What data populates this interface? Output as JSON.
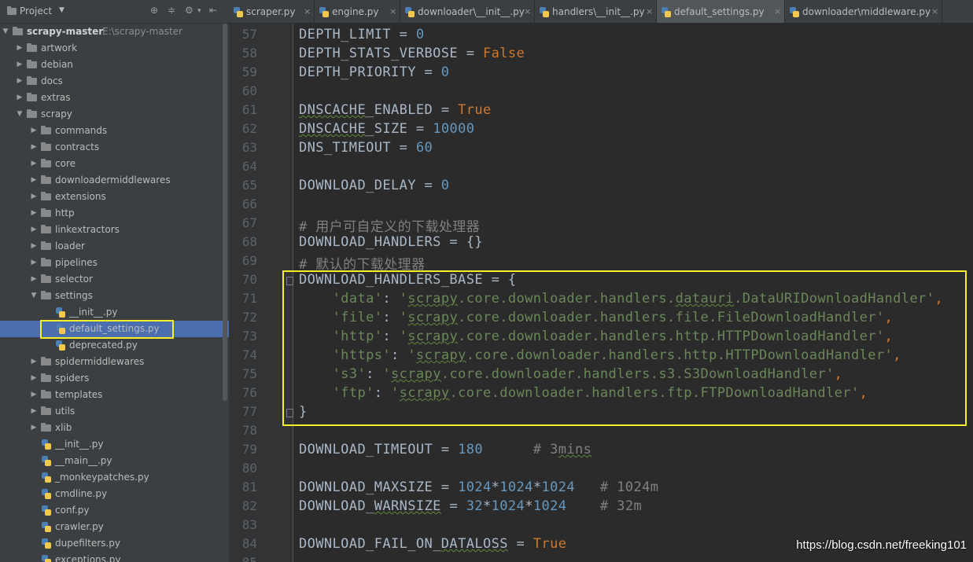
{
  "project": {
    "title": "Project",
    "tree": [
      {
        "label": "scrapy-master",
        "sublabel": "E:\\scrapy-master",
        "kind": "folder",
        "depth": 0,
        "expanded": true,
        "bold": true
      },
      {
        "label": "artwork",
        "kind": "folder",
        "depth": 1,
        "expanded": false
      },
      {
        "label": "debian",
        "kind": "folder",
        "depth": 1,
        "expanded": false
      },
      {
        "label": "docs",
        "kind": "folder",
        "depth": 1,
        "expanded": false
      },
      {
        "label": "extras",
        "kind": "folder",
        "depth": 1,
        "expanded": false
      },
      {
        "label": "scrapy",
        "kind": "folder",
        "depth": 1,
        "expanded": true
      },
      {
        "label": "commands",
        "kind": "folder",
        "depth": 2,
        "expanded": false
      },
      {
        "label": "contracts",
        "kind": "folder",
        "depth": 2,
        "expanded": false
      },
      {
        "label": "core",
        "kind": "folder",
        "depth": 2,
        "expanded": false
      },
      {
        "label": "downloadermiddlewares",
        "kind": "folder",
        "depth": 2,
        "expanded": false
      },
      {
        "label": "extensions",
        "kind": "folder",
        "depth": 2,
        "expanded": false
      },
      {
        "label": "http",
        "kind": "folder",
        "depth": 2,
        "expanded": false
      },
      {
        "label": "linkextractors",
        "kind": "folder",
        "depth": 2,
        "expanded": false
      },
      {
        "label": "loader",
        "kind": "folder",
        "depth": 2,
        "expanded": false
      },
      {
        "label": "pipelines",
        "kind": "folder",
        "depth": 2,
        "expanded": false
      },
      {
        "label": "selector",
        "kind": "folder",
        "depth": 2,
        "expanded": false
      },
      {
        "label": "settings",
        "kind": "folder",
        "depth": 2,
        "expanded": true
      },
      {
        "label": "__init__.py",
        "kind": "file",
        "depth": 3
      },
      {
        "label": "default_settings.py",
        "kind": "file",
        "depth": 3,
        "selected": true
      },
      {
        "label": "deprecated.py",
        "kind": "file",
        "depth": 3
      },
      {
        "label": "spidermiddlewares",
        "kind": "folder",
        "depth": 2,
        "expanded": false
      },
      {
        "label": "spiders",
        "kind": "folder",
        "depth": 2,
        "expanded": false
      },
      {
        "label": "templates",
        "kind": "folder",
        "depth": 2,
        "expanded": false
      },
      {
        "label": "utils",
        "kind": "folder",
        "depth": 2,
        "expanded": false
      },
      {
        "label": "xlib",
        "kind": "folder",
        "depth": 2,
        "expanded": false
      },
      {
        "label": "__init__.py",
        "kind": "file",
        "depth": 2
      },
      {
        "label": "__main__.py",
        "kind": "file",
        "depth": 2
      },
      {
        "label": "_monkeypatches.py",
        "kind": "file",
        "depth": 2
      },
      {
        "label": "cmdline.py",
        "kind": "file",
        "depth": 2
      },
      {
        "label": "conf.py",
        "kind": "file",
        "depth": 2
      },
      {
        "label": "crawler.py",
        "kind": "file",
        "depth": 2
      },
      {
        "label": "dupefilters.py",
        "kind": "file",
        "depth": 2
      },
      {
        "label": "exceptions.py",
        "kind": "file",
        "depth": 2
      }
    ]
  },
  "tabs": [
    {
      "label": "scraper.py",
      "active": false
    },
    {
      "label": "engine.py",
      "active": false
    },
    {
      "label": "downloader\\__init__.py",
      "active": false
    },
    {
      "label": "handlers\\__init__.py",
      "active": false
    },
    {
      "label": "default_settings.py",
      "active": true
    },
    {
      "label": "downloader\\middleware.py",
      "active": false
    }
  ],
  "editor": {
    "lines": [
      {
        "n": 57,
        "parts": [
          [
            "DEPTH_LIMIT",
            ""
          ],
          [
            " = ",
            ""
          ],
          [
            "0",
            "num"
          ]
        ]
      },
      {
        "n": 58,
        "parts": [
          [
            "DEPTH_STATS_VERBOSE",
            ""
          ],
          [
            " = ",
            ""
          ],
          [
            "False",
            "kw"
          ]
        ]
      },
      {
        "n": 59,
        "parts": [
          [
            "DEPTH_PRIORITY",
            ""
          ],
          [
            " = ",
            ""
          ],
          [
            "0",
            "num"
          ]
        ]
      },
      {
        "n": 60,
        "parts": []
      },
      {
        "n": 61,
        "parts": [
          [
            "DNSCACHE",
            "wv"
          ],
          [
            "_ENABLED",
            ""
          ],
          [
            " = ",
            ""
          ],
          [
            "True",
            "kw"
          ]
        ]
      },
      {
        "n": 62,
        "parts": [
          [
            "DNSCACHE",
            "wv"
          ],
          [
            "_SIZE",
            ""
          ],
          [
            " = ",
            ""
          ],
          [
            "10000",
            "num"
          ]
        ]
      },
      {
        "n": 63,
        "parts": [
          [
            "DNS_TIMEOUT",
            ""
          ],
          [
            " = ",
            ""
          ],
          [
            "60",
            "num"
          ]
        ]
      },
      {
        "n": 64,
        "parts": []
      },
      {
        "n": 65,
        "parts": [
          [
            "DOWNLOAD_DELAY",
            ""
          ],
          [
            " = ",
            ""
          ],
          [
            "0",
            "num"
          ]
        ]
      },
      {
        "n": 66,
        "parts": []
      },
      {
        "n": 67,
        "parts": [
          [
            "# 用户可自定义的下载处理器",
            "cm"
          ]
        ]
      },
      {
        "n": 68,
        "parts": [
          [
            "DOWNLOAD_HANDLERS",
            ""
          ],
          [
            " = {}",
            ""
          ]
        ]
      },
      {
        "n": 69,
        "parts": [
          [
            "# 默认的下载处理器",
            "cm"
          ]
        ]
      },
      {
        "n": 70,
        "parts": [
          [
            "DOWNLOAD_HANDLERS_BASE",
            ""
          ],
          [
            " = {",
            ""
          ]
        ]
      },
      {
        "n": 71,
        "parts": [
          [
            "    ",
            ""
          ],
          [
            "'data'",
            "str"
          ],
          [
            ": ",
            ""
          ],
          [
            "'",
            "str"
          ],
          [
            "scrapy",
            "str wv"
          ],
          [
            ".core.downloader.handlers.",
            "str"
          ],
          [
            "datauri",
            "str wv"
          ],
          [
            ".DataURIDownloadHandler'",
            "str"
          ],
          [
            ",",
            "kw"
          ]
        ]
      },
      {
        "n": 72,
        "parts": [
          [
            "    ",
            ""
          ],
          [
            "'file'",
            "str"
          ],
          [
            ": ",
            ""
          ],
          [
            "'",
            "str"
          ],
          [
            "scrapy",
            "str wv"
          ],
          [
            ".core.downloader.handlers.file.FileDownloadHandler'",
            "str"
          ],
          [
            ",",
            "kw"
          ]
        ]
      },
      {
        "n": 73,
        "parts": [
          [
            "    ",
            ""
          ],
          [
            "'http'",
            "str"
          ],
          [
            ": ",
            ""
          ],
          [
            "'",
            "str"
          ],
          [
            "scrapy",
            "str wv"
          ],
          [
            ".core.downloader.handlers.http.HTTPDownloadHandler'",
            "str"
          ],
          [
            ",",
            "kw"
          ]
        ]
      },
      {
        "n": 74,
        "parts": [
          [
            "    ",
            ""
          ],
          [
            "'https'",
            "str"
          ],
          [
            ": ",
            ""
          ],
          [
            "'",
            "str"
          ],
          [
            "scrapy",
            "str wv"
          ],
          [
            ".core.downloader.handlers.http.HTTPDownloadHandler'",
            "str"
          ],
          [
            ",",
            "kw"
          ]
        ]
      },
      {
        "n": 75,
        "parts": [
          [
            "    ",
            ""
          ],
          [
            "'s3'",
            "str"
          ],
          [
            ": ",
            ""
          ],
          [
            "'",
            "str"
          ],
          [
            "scrapy",
            "str wv"
          ],
          [
            ".core.downloader.handlers.s3.S3DownloadHandler'",
            "str"
          ],
          [
            ",",
            "kw"
          ]
        ]
      },
      {
        "n": 76,
        "parts": [
          [
            "    ",
            ""
          ],
          [
            "'ftp'",
            "str"
          ],
          [
            ": ",
            ""
          ],
          [
            "'",
            "str"
          ],
          [
            "scrapy",
            "str wv"
          ],
          [
            ".core.downloader.handlers.ftp.FTPDownloadHandler'",
            "str"
          ],
          [
            ",",
            "kw"
          ]
        ]
      },
      {
        "n": 77,
        "parts": [
          [
            "}",
            ""
          ]
        ]
      },
      {
        "n": 78,
        "parts": []
      },
      {
        "n": 79,
        "parts": [
          [
            "DOWNLOAD_TIMEOUT",
            ""
          ],
          [
            " = ",
            ""
          ],
          [
            "180",
            "num"
          ],
          [
            "      # 3",
            "cm"
          ],
          [
            "mins",
            "cm wv"
          ]
        ]
      },
      {
        "n": 80,
        "parts": []
      },
      {
        "n": 81,
        "parts": [
          [
            "DOWNLOAD_MAXSIZE",
            ""
          ],
          [
            " = ",
            ""
          ],
          [
            "1024",
            "num"
          ],
          [
            "*",
            ""
          ],
          [
            "1024",
            "num"
          ],
          [
            "*",
            ""
          ],
          [
            "1024",
            "num"
          ],
          [
            "   # 1024m",
            "cm"
          ]
        ]
      },
      {
        "n": 82,
        "parts": [
          [
            "DOWNLOAD_",
            ""
          ],
          [
            "WARNSIZE",
            "wv"
          ],
          [
            " = ",
            ""
          ],
          [
            "32",
            "num"
          ],
          [
            "*",
            ""
          ],
          [
            "1024",
            "num"
          ],
          [
            "*",
            ""
          ],
          [
            "1024",
            "num"
          ],
          [
            "    # 32m",
            "cm"
          ]
        ]
      },
      {
        "n": 83,
        "parts": []
      },
      {
        "n": 84,
        "parts": [
          [
            "DOWNLOAD_FAIL_ON_",
            ""
          ],
          [
            "DATALOSS",
            "wv"
          ],
          [
            " = ",
            ""
          ],
          [
            "True",
            "kw"
          ]
        ]
      },
      {
        "n": 85,
        "parts": []
      }
    ]
  },
  "watermark": "https://blog.csdn.net/freeking101"
}
